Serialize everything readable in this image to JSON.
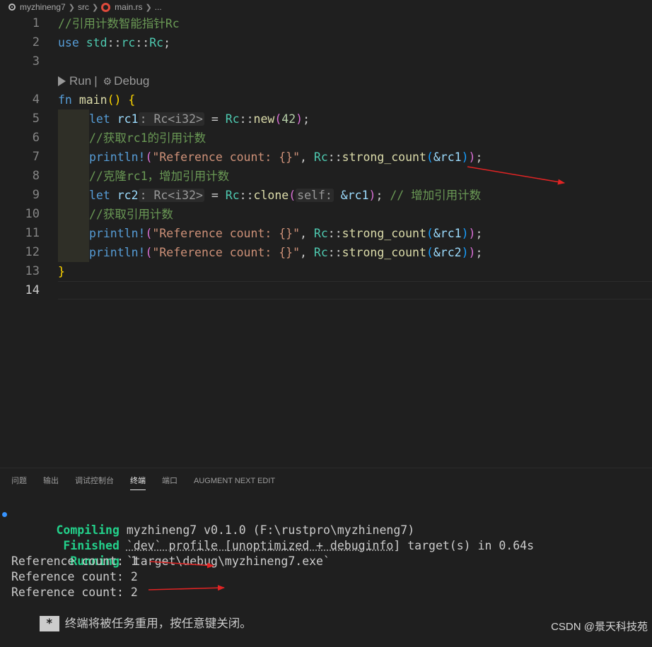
{
  "breadcrumb": {
    "project": "myzhineng7",
    "folder": "src",
    "file": "main.rs",
    "more": "..."
  },
  "editor": {
    "line_numbers": [
      "1",
      "2",
      "3",
      "4",
      "5",
      "6",
      "7",
      "8",
      "9",
      "10",
      "11",
      "12",
      "13",
      "14"
    ],
    "codelens": {
      "run": "Run",
      "separator": "|",
      "debug": "Debug"
    },
    "lines": {
      "l1": {
        "comment": "//引用计数智能指针Rc"
      },
      "l2": {
        "kw": "use",
        "path1": "std",
        "sep1": "::",
        "path2": "rc",
        "sep2": "::",
        "type": "Rc",
        "semi": ";"
      },
      "l4": {
        "kw": "fn",
        "name": "main",
        "open": "()",
        "brace": "{"
      },
      "l5": {
        "kw": "let",
        "var": "rc1",
        "hint_colon": ":",
        "hint_type": "Rc<i32>",
        "eq": "=",
        "type": "Rc",
        "sep": "::",
        "fn": "new",
        "paren_open": "(",
        "num": "42",
        "paren_close": ")",
        "semi": ";"
      },
      "l6": {
        "comment": "//获取rc1的引用计数"
      },
      "l7": {
        "macro": "println!",
        "paren_open": "(",
        "str": "\"Reference count: {}\"",
        "comma": ",",
        "type": "Rc",
        "sep": "::",
        "fn": "strong_count",
        "inner_open": "(",
        "arg": "&rc1",
        "inner_close": ")",
        "paren_close": ")",
        "semi": ";"
      },
      "l8": {
        "comment": "//克隆rc1，增加引用计数"
      },
      "l9": {
        "kw": "let",
        "var": "rc2",
        "hint_colon": ":",
        "hint_type": "Rc<i32>",
        "eq": "=",
        "type": "Rc",
        "sep": "::",
        "fn": "clone",
        "paren_open": "(",
        "param_hint": "self:",
        "arg": "&rc1",
        "paren_close": ")",
        "semi": ";",
        "comment": "// 增加引用计数"
      },
      "l10": {
        "comment": "//获取引用计数"
      },
      "l11": {
        "macro": "println!",
        "paren_open": "(",
        "str": "\"Reference count: {}\"",
        "comma": ",",
        "type": "Rc",
        "sep": "::",
        "fn": "strong_count",
        "inner_open": "(",
        "arg": "&rc1",
        "inner_close": ")",
        "paren_close": ")",
        "semi": ";"
      },
      "l12": {
        "macro": "println!",
        "paren_open": "(",
        "str": "\"Reference count: {}\"",
        "comma": ",",
        "type": "Rc",
        "sep": "::",
        "fn": "strong_count",
        "inner_open": "(",
        "arg": "&rc2",
        "inner_close": ")",
        "paren_close": ")",
        "semi": ";"
      },
      "l13": {
        "brace": "}"
      }
    }
  },
  "panel": {
    "tabs": [
      "问题",
      "输出",
      "调试控制台",
      "终端",
      "端口",
      "AUGMENT NEXT EDIT"
    ],
    "active_tab": "终端"
  },
  "terminal": {
    "compiling_label": "Compiling",
    "compiling_text": "myzhineng7 v0.1.0 (F:\\rustpro\\myzhineng7)",
    "finished_label": "Finished",
    "finished_profile": "`dev` profile [unoptimized + debuginfo]",
    "finished_rest": "target(s) in 0.64s",
    "running_label": "Running",
    "running_text": "`target\\debug\\myzhineng7.exe`",
    "output": [
      "Reference count: 1",
      "Reference count: 2",
      "Reference count: 2"
    ],
    "badge": "*",
    "close_message": "终端将被任务重用，按任意键关闭。"
  },
  "watermark": "CSDN @景天科技苑",
  "colors": {
    "arrow": "#e02424",
    "terminal_green": "#23d18b",
    "keyword": "#569cd6",
    "type": "#4ec9b0",
    "function": "#dcdcaa",
    "comment": "#6a9955",
    "string": "#ce9178"
  }
}
